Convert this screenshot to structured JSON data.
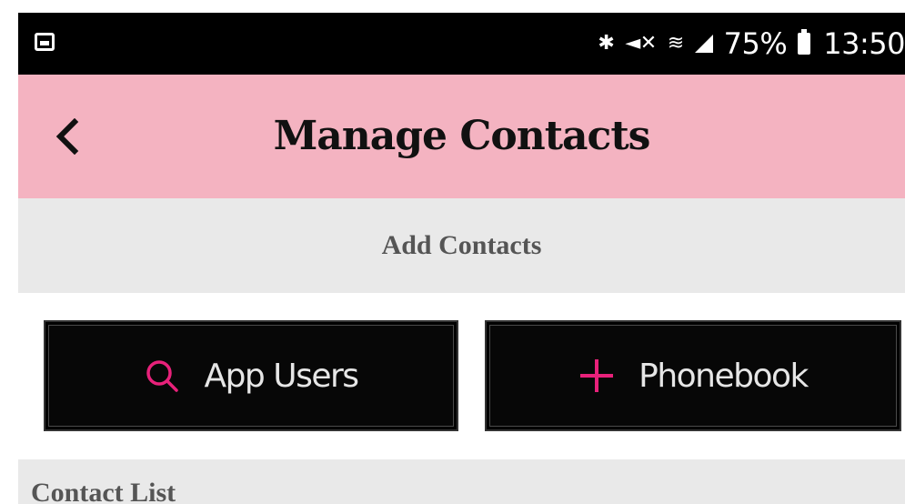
{
  "status_bar": {
    "battery_percent": "75%",
    "time": "13:50",
    "icons": [
      "image-icon",
      "bluetooth-icon",
      "mute-icon",
      "wifi-icon",
      "signal-icon",
      "battery-icon"
    ]
  },
  "header": {
    "title": "Manage Contacts",
    "back_icon": "chevron-left-icon",
    "background": "#f4b3c1"
  },
  "add_section": {
    "title": "Add Contacts"
  },
  "buttons": [
    {
      "label": "App Users",
      "icon": "search-icon"
    },
    {
      "label": "Phonebook",
      "icon": "plus-icon"
    }
  ],
  "list_section": {
    "title": "Contact List"
  },
  "colors": {
    "accent": "#e8217a",
    "header": "#f4b3c1",
    "section_bg": "#e9e9e9",
    "button_bg": "#070707"
  }
}
